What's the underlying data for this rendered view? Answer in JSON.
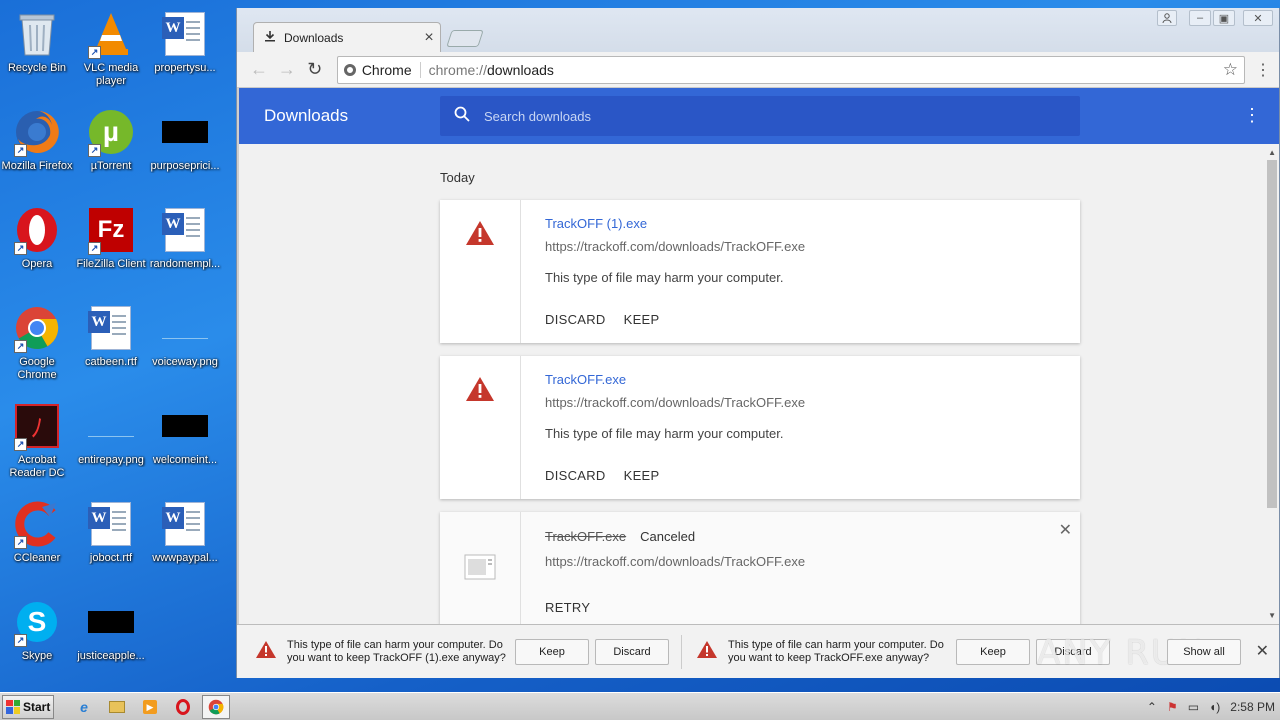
{
  "desktop": {
    "icons": [
      {
        "label": "Recycle Bin"
      },
      {
        "label": "VLC media player"
      },
      {
        "label": "propertysu..."
      },
      {
        "label": "Mozilla Firefox"
      },
      {
        "label": "µTorrent"
      },
      {
        "label": "purposeprici..."
      },
      {
        "label": "Opera"
      },
      {
        "label": "FileZilla Client"
      },
      {
        "label": "randomempl..."
      },
      {
        "label": "Google Chrome"
      },
      {
        "label": "catbeen.rtf"
      },
      {
        "label": "voiceway.png"
      },
      {
        "label": "Acrobat Reader DC"
      },
      {
        "label": "entirepay.png"
      },
      {
        "label": "welcomeint..."
      },
      {
        "label": "CCleaner"
      },
      {
        "label": "joboct.rtf"
      },
      {
        "label": "wwwpaypal..."
      },
      {
        "label": "Skype"
      },
      {
        "label": "justiceapple..."
      }
    ]
  },
  "browser": {
    "tab_title": "Downloads",
    "omnibox": {
      "chip": "Chrome",
      "url_scheme": "chrome://",
      "url_rest": "downloads"
    }
  },
  "downloads_page": {
    "title": "Downloads",
    "search_placeholder": "Search downloads",
    "date_label": "Today",
    "items": [
      {
        "file_name": "TrackOFF (1).exe",
        "url": "https://trackoff.com/downloads/TrackOFF.exe",
        "warning": "This type of file may harm your computer.",
        "discard_label": "DISCARD",
        "keep_label": "KEEP"
      },
      {
        "file_name": "TrackOFF.exe",
        "url": "https://trackoff.com/downloads/TrackOFF.exe",
        "warning": "This type of file may harm your computer.",
        "discard_label": "DISCARD",
        "keep_label": "KEEP"
      },
      {
        "file_name": "TrackOFF.exe",
        "status": "Canceled",
        "url": "https://trackoff.com/downloads/TrackOFF.exe",
        "retry_label": "RETRY"
      }
    ]
  },
  "shelf": {
    "items": [
      {
        "message": "This type of file can harm your computer. Do you want to keep TrackOFF (1).exe anyway?",
        "keep_label": "Keep",
        "discard_label": "Discard"
      },
      {
        "message": "This type of file can harm your computer. Do you want to keep TrackOFF.exe anyway?",
        "keep_label": "Keep",
        "discard_label": "Discard"
      }
    ],
    "show_all_label": "Show all",
    "watermark": "ANY RUN"
  },
  "taskbar": {
    "start_label": "Start",
    "clock": "2:58 PM"
  },
  "colors": {
    "header_blue": "#3367d6",
    "warning_red": "#c5372c",
    "desktop_blue": "#1a6fd8"
  }
}
